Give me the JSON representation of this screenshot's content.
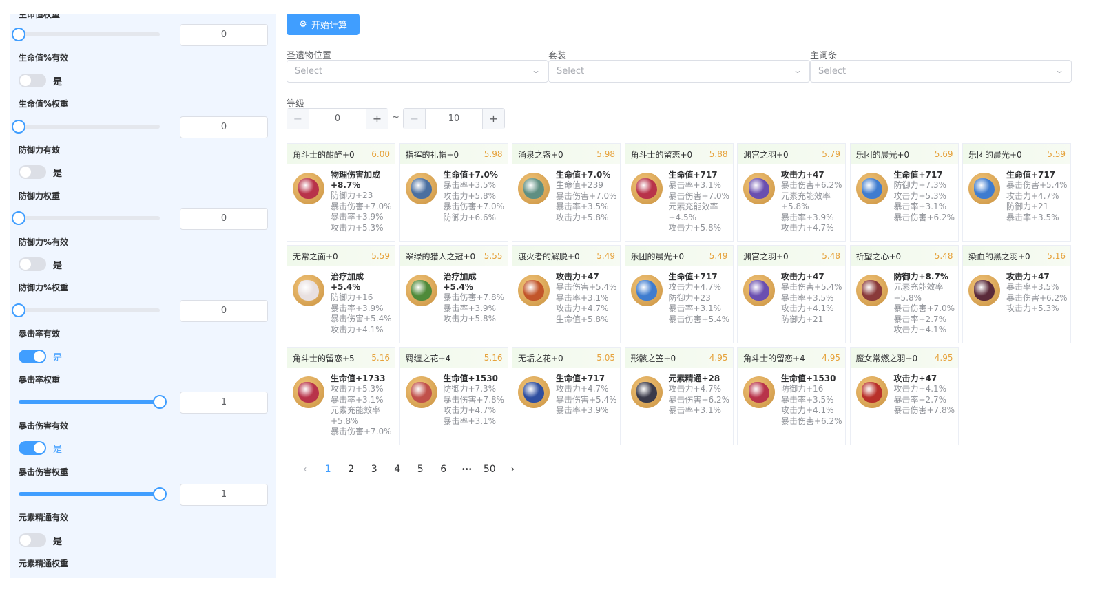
{
  "sidebar": {
    "cut_label": "生命值权重",
    "rows": [
      {
        "kind": "slider",
        "value": 0,
        "input": "0"
      },
      {
        "kind": "label",
        "text": "生命值%有效"
      },
      {
        "kind": "switch",
        "on": false,
        "text": "是"
      },
      {
        "kind": "label",
        "text": "生命值%权重"
      },
      {
        "kind": "slider",
        "value": 0,
        "input": "0"
      },
      {
        "kind": "label",
        "text": "防御力有效"
      },
      {
        "kind": "switch",
        "on": false,
        "text": "是"
      },
      {
        "kind": "label",
        "text": "防御力权重"
      },
      {
        "kind": "slider",
        "value": 0,
        "input": "0"
      },
      {
        "kind": "label",
        "text": "防御力%有效"
      },
      {
        "kind": "switch",
        "on": false,
        "text": "是"
      },
      {
        "kind": "label",
        "text": "防御力%权重"
      },
      {
        "kind": "slider",
        "value": 0,
        "input": "0"
      },
      {
        "kind": "label",
        "text": "暴击率有效"
      },
      {
        "kind": "switch",
        "on": true,
        "text": "是"
      },
      {
        "kind": "label",
        "text": "暴击率权重"
      },
      {
        "kind": "slider",
        "value": 1,
        "input": "1"
      },
      {
        "kind": "label",
        "text": "暴击伤害有效"
      },
      {
        "kind": "switch",
        "on": true,
        "text": "是"
      },
      {
        "kind": "label",
        "text": "暴击伤害权重"
      },
      {
        "kind": "slider",
        "value": 1,
        "input": "1"
      },
      {
        "kind": "label",
        "text": "元素精通有效"
      },
      {
        "kind": "switch",
        "on": false,
        "text": "是"
      },
      {
        "kind": "label",
        "text": "元素精通权重"
      }
    ]
  },
  "toolbar": {
    "start_label": "开始计算"
  },
  "filters": {
    "position_label": "圣遗物位置",
    "set_label": "套装",
    "main_label": "主词条",
    "placeholder": "Select"
  },
  "level": {
    "label": "等级",
    "min": "0",
    "max": "10",
    "tilde": "~",
    "minus": "−",
    "plus": "+"
  },
  "cards": [
    {
      "name": "角斗士的酣醉+0",
      "score": "6.00",
      "icon": "goblet",
      "color": "#b8334a",
      "main": [
        "物理伤害加成",
        "+8.7%"
      ],
      "subs": [
        "防御力+23",
        "暴击伤害+7.0%",
        "暴击率+3.9%",
        "攻击力+5.3%"
      ]
    },
    {
      "name": "指挥的礼帽+0",
      "score": "5.98",
      "icon": "hat",
      "color": "#4a6fa0",
      "main": [
        "生命值+7.0%"
      ],
      "subs": [
        "暴击率+3.5%",
        "攻击力+5.8%",
        "暴击伤害+7.0%",
        "防御力+6.6%"
      ]
    },
    {
      "name": "涌泉之盏+0",
      "score": "5.98",
      "icon": "goblet",
      "color": "#5f8f82",
      "main": [
        "生命值+7.0%"
      ],
      "subs": [
        "生命值+239",
        "暴击伤害+7.0%",
        "暴击率+3.5%",
        "攻击力+5.8%"
      ]
    },
    {
      "name": "角斗士的留恋+0",
      "score": "5.88",
      "icon": "flower",
      "color": "#b8334a",
      "main": [
        "生命值+717"
      ],
      "subs": [
        "暴击率+3.1%",
        "暴击伤害+7.0%",
        "元素充能效率",
        "+4.5%",
        "攻击力+5.8%"
      ]
    },
    {
      "name": "渊宫之羽+0",
      "score": "5.79",
      "icon": "feather",
      "color": "#6a4fb0",
      "main": [
        "攻击力+47"
      ],
      "subs": [
        "暴击伤害+6.2%",
        "元素充能效率",
        "+5.8%",
        "暴击率+3.9%",
        "攻击力+4.7%"
      ]
    },
    {
      "name": "乐团的晨光+0",
      "score": "5.69",
      "icon": "flower",
      "color": "#3f7ccf",
      "main": [
        "生命值+717"
      ],
      "subs": [
        "防御力+7.3%",
        "攻击力+5.3%",
        "暴击率+3.1%",
        "暴击伤害+6.2%"
      ]
    },
    {
      "name": "乐团的晨光+0",
      "score": "5.59",
      "icon": "flower",
      "color": "#3f7ccf",
      "main": [
        "生命值+717"
      ],
      "subs": [
        "暴击伤害+5.4%",
        "攻击力+4.7%",
        "防御力+21",
        "暴击率+3.5%"
      ]
    },
    {
      "name": "无常之面+0",
      "score": "5.59",
      "icon": "mask",
      "color": "#e8e0e0",
      "main": [
        "治疗加成+5.4%"
      ],
      "subs": [
        "防御力+16",
        "暴击率+3.9%",
        "暴击伤害+5.4%",
        "攻击力+4.1%"
      ]
    },
    {
      "name": "翠绿的猎人之冠+0",
      "score": "5.55",
      "icon": "hat",
      "color": "#4f8a3a",
      "main": [
        "治疗加成+5.4%"
      ],
      "subs": [
        "暴击伤害+7.8%",
        "暴击率+3.9%",
        "攻击力+5.8%"
      ]
    },
    {
      "name": "渡火者的解脱+0",
      "score": "5.49",
      "icon": "sand",
      "color": "#c2552a",
      "main": [
        "攻击力+47"
      ],
      "subs": [
        "暴击伤害+5.4%",
        "暴击率+3.1%",
        "攻击力+4.7%",
        "生命值+5.8%"
      ]
    },
    {
      "name": "乐团的晨光+0",
      "score": "5.49",
      "icon": "flower",
      "color": "#3f7ccf",
      "main": [
        "生命值+717"
      ],
      "subs": [
        "攻击力+4.7%",
        "防御力+23",
        "暴击率+3.1%",
        "暴击伤害+5.4%"
      ]
    },
    {
      "name": "渊宫之羽+0",
      "score": "5.48",
      "icon": "feather",
      "color": "#6a4fb0",
      "main": [
        "攻击力+47"
      ],
      "subs": [
        "暴击伤害+5.4%",
        "暴击率+3.5%",
        "攻击力+4.1%",
        "防御力+21"
      ]
    },
    {
      "name": "祈望之心+0",
      "score": "5.48",
      "icon": "goblet",
      "color": "#8a3a3a",
      "main": [
        "防御力+8.7%"
      ],
      "subs": [
        "元素充能效率",
        "+5.8%",
        "暴击伤害+7.0%",
        "暴击率+2.7%",
        "攻击力+4.1%"
      ]
    },
    {
      "name": "染血的黑之羽+0",
      "score": "5.16",
      "icon": "feather",
      "color": "#5a2a3a",
      "main": [
        "攻击力+47"
      ],
      "subs": [
        "暴击率+3.5%",
        "暴击伤害+6.2%",
        "攻击力+5.3%"
      ]
    },
    {
      "name": "角斗士的留恋+5",
      "score": "5.16",
      "icon": "flower",
      "color": "#b8334a",
      "main": [
        "生命值+1733"
      ],
      "subs": [
        "攻击力+5.3%",
        "暴击率+3.1%",
        "元素充能效率",
        "+5.8%",
        "暴击伤害+7.0%"
      ]
    },
    {
      "name": "羁缠之花+4",
      "score": "5.16",
      "icon": "flower",
      "color": "#c0504a",
      "main": [
        "生命值+1530"
      ],
      "subs": [
        "防御力+7.3%",
        "暴击伤害+7.8%",
        "攻击力+4.7%",
        "暴击率+3.1%"
      ]
    },
    {
      "name": "无垢之花+0",
      "score": "5.05",
      "icon": "flower",
      "color": "#2f4fa0",
      "main": [
        "生命值+717"
      ],
      "subs": [
        "攻击力+4.7%",
        "暴击伤害+5.4%",
        "暴击率+3.9%"
      ]
    },
    {
      "name": "形骸之笠+0",
      "score": "4.95",
      "icon": "hat",
      "color": "#3a3a4a",
      "main": [
        "元素精通+28"
      ],
      "subs": [
        "攻击力+4.7%",
        "暴击伤害+6.2%",
        "暴击率+3.1%"
      ]
    },
    {
      "name": "角斗士的留恋+4",
      "score": "4.95",
      "icon": "flower",
      "color": "#b8334a",
      "main": [
        "生命值+1530"
      ],
      "subs": [
        "防御力+16",
        "暴击率+3.5%",
        "攻击力+4.1%",
        "暴击伤害+6.2%"
      ]
    },
    {
      "name": "魔女常燃之羽+0",
      "score": "4.95",
      "icon": "feather",
      "color": "#b8302a",
      "main": [
        "攻击力+47"
      ],
      "subs": [
        "攻击力+4.1%",
        "暴击率+2.7%",
        "暴击伤害+7.8%"
      ]
    }
  ],
  "pagination": {
    "prev": "‹",
    "pages": [
      "1",
      "2",
      "3",
      "4",
      "5",
      "6"
    ],
    "ellipsis": "•••",
    "last": "50",
    "next": "›",
    "current": "1"
  },
  "colors": {
    "accent": "#409eff",
    "score": "#e6a23c"
  }
}
